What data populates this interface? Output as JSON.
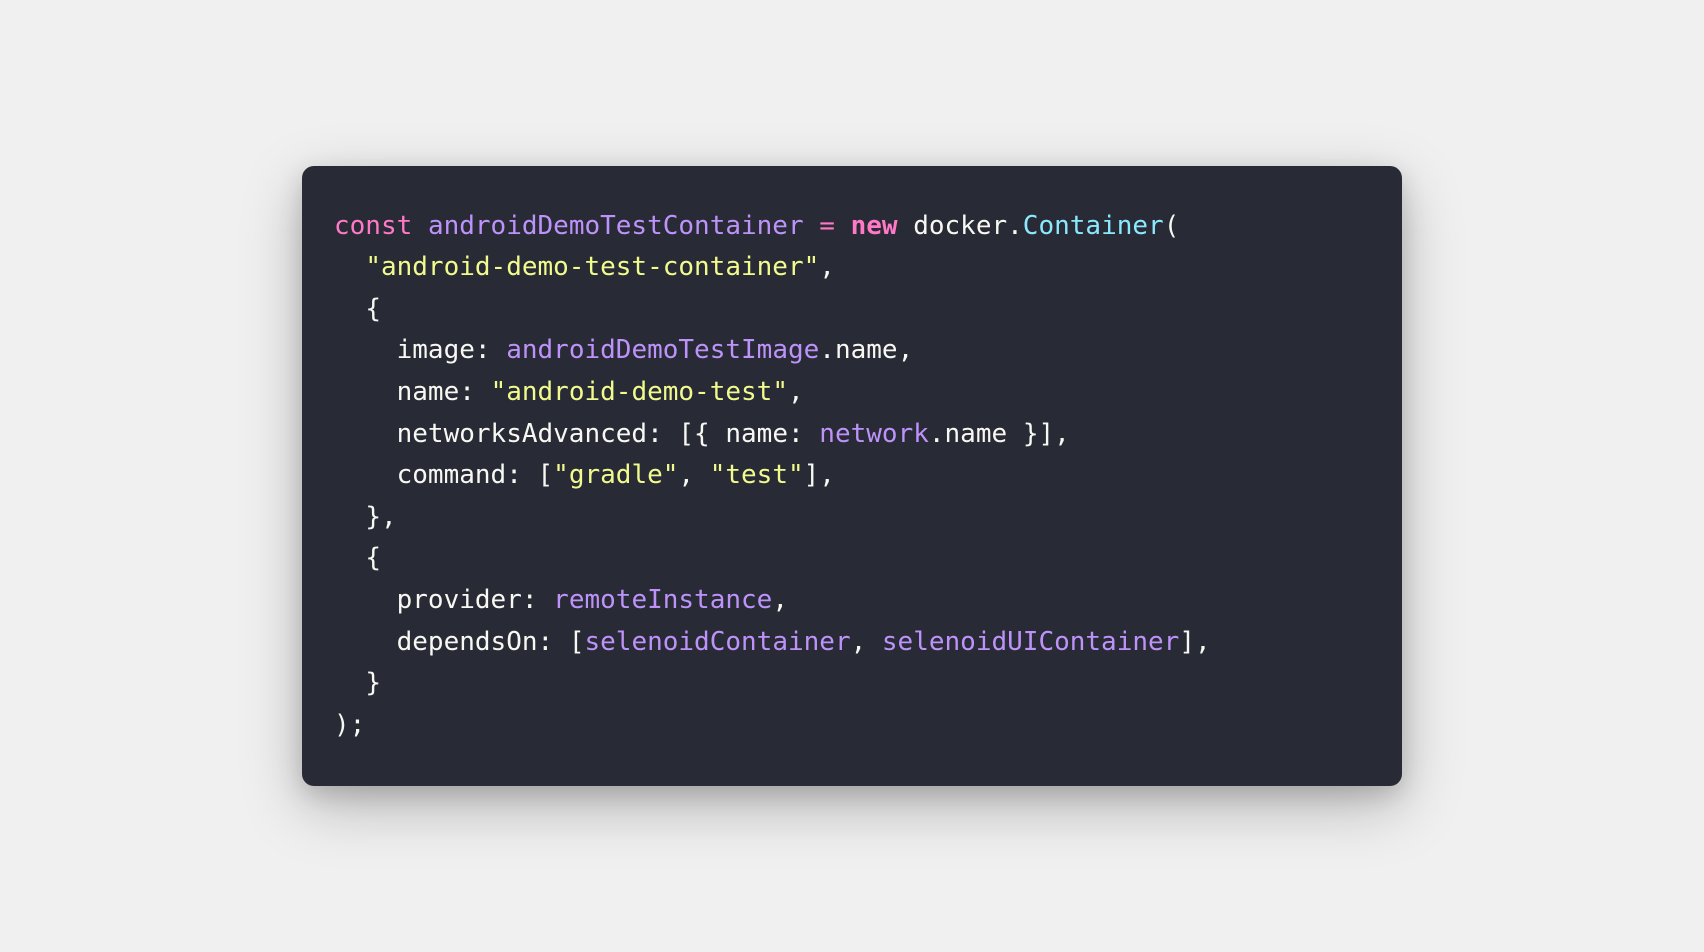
{
  "code": {
    "tokens": [
      {
        "text": "const",
        "class": "keyword"
      },
      {
        "text": " ",
        "class": "default"
      },
      {
        "text": "androidDemoTestContainer",
        "class": "variable"
      },
      {
        "text": " ",
        "class": "default"
      },
      {
        "text": "=",
        "class": "operator"
      },
      {
        "text": " ",
        "class": "default"
      },
      {
        "text": "new",
        "class": "keyword-bold"
      },
      {
        "text": " ",
        "class": "default"
      },
      {
        "text": "docker",
        "class": "default"
      },
      {
        "text": ".",
        "class": "punctuation"
      },
      {
        "text": "Container",
        "class": "class-name"
      },
      {
        "text": "(",
        "class": "punctuation"
      },
      {
        "text": "\n  ",
        "class": "default"
      },
      {
        "text": "\"android-demo-test-container\"",
        "class": "string"
      },
      {
        "text": ",",
        "class": "punctuation"
      },
      {
        "text": "\n  ",
        "class": "default"
      },
      {
        "text": "{",
        "class": "punctuation"
      },
      {
        "text": "\n    ",
        "class": "default"
      },
      {
        "text": "image",
        "class": "property"
      },
      {
        "text": ":",
        "class": "punctuation"
      },
      {
        "text": " ",
        "class": "default"
      },
      {
        "text": "androidDemoTestImage",
        "class": "variable"
      },
      {
        "text": ".",
        "class": "punctuation"
      },
      {
        "text": "name",
        "class": "property"
      },
      {
        "text": ",",
        "class": "punctuation"
      },
      {
        "text": "\n    ",
        "class": "default"
      },
      {
        "text": "name",
        "class": "property"
      },
      {
        "text": ":",
        "class": "punctuation"
      },
      {
        "text": " ",
        "class": "default"
      },
      {
        "text": "\"android-demo-test\"",
        "class": "string"
      },
      {
        "text": ",",
        "class": "punctuation"
      },
      {
        "text": "\n    ",
        "class": "default"
      },
      {
        "text": "networksAdvanced",
        "class": "property"
      },
      {
        "text": ":",
        "class": "punctuation"
      },
      {
        "text": " ",
        "class": "default"
      },
      {
        "text": "[",
        "class": "punctuation"
      },
      {
        "text": "{",
        "class": "punctuation"
      },
      {
        "text": " ",
        "class": "default"
      },
      {
        "text": "name",
        "class": "property"
      },
      {
        "text": ":",
        "class": "punctuation"
      },
      {
        "text": " ",
        "class": "default"
      },
      {
        "text": "network",
        "class": "variable"
      },
      {
        "text": ".",
        "class": "punctuation"
      },
      {
        "text": "name",
        "class": "property"
      },
      {
        "text": " ",
        "class": "default"
      },
      {
        "text": "}",
        "class": "punctuation"
      },
      {
        "text": "]",
        "class": "punctuation"
      },
      {
        "text": ",",
        "class": "punctuation"
      },
      {
        "text": "\n    ",
        "class": "default"
      },
      {
        "text": "command",
        "class": "property"
      },
      {
        "text": ":",
        "class": "punctuation"
      },
      {
        "text": " ",
        "class": "default"
      },
      {
        "text": "[",
        "class": "punctuation"
      },
      {
        "text": "\"gradle\"",
        "class": "string"
      },
      {
        "text": ",",
        "class": "punctuation"
      },
      {
        "text": " ",
        "class": "default"
      },
      {
        "text": "\"test\"",
        "class": "string"
      },
      {
        "text": "]",
        "class": "punctuation"
      },
      {
        "text": ",",
        "class": "punctuation"
      },
      {
        "text": "\n  ",
        "class": "default"
      },
      {
        "text": "}",
        "class": "punctuation"
      },
      {
        "text": ",",
        "class": "punctuation"
      },
      {
        "text": "\n  ",
        "class": "default"
      },
      {
        "text": "{",
        "class": "punctuation"
      },
      {
        "text": "\n    ",
        "class": "default"
      },
      {
        "text": "provider",
        "class": "property"
      },
      {
        "text": ":",
        "class": "punctuation"
      },
      {
        "text": " ",
        "class": "default"
      },
      {
        "text": "remoteInstance",
        "class": "variable"
      },
      {
        "text": ",",
        "class": "punctuation"
      },
      {
        "text": "\n    ",
        "class": "default"
      },
      {
        "text": "dependsOn",
        "class": "property"
      },
      {
        "text": ":",
        "class": "punctuation"
      },
      {
        "text": " ",
        "class": "default"
      },
      {
        "text": "[",
        "class": "punctuation"
      },
      {
        "text": "selenoidContainer",
        "class": "variable"
      },
      {
        "text": ",",
        "class": "punctuation"
      },
      {
        "text": " ",
        "class": "default"
      },
      {
        "text": "selenoidUIContainer",
        "class": "variable"
      },
      {
        "text": "]",
        "class": "punctuation"
      },
      {
        "text": ",",
        "class": "punctuation"
      },
      {
        "text": "\n  ",
        "class": "default"
      },
      {
        "text": "}",
        "class": "punctuation"
      },
      {
        "text": "\n",
        "class": "default"
      },
      {
        "text": ")",
        "class": "punctuation"
      },
      {
        "text": ";",
        "class": "punctuation"
      }
    ]
  }
}
